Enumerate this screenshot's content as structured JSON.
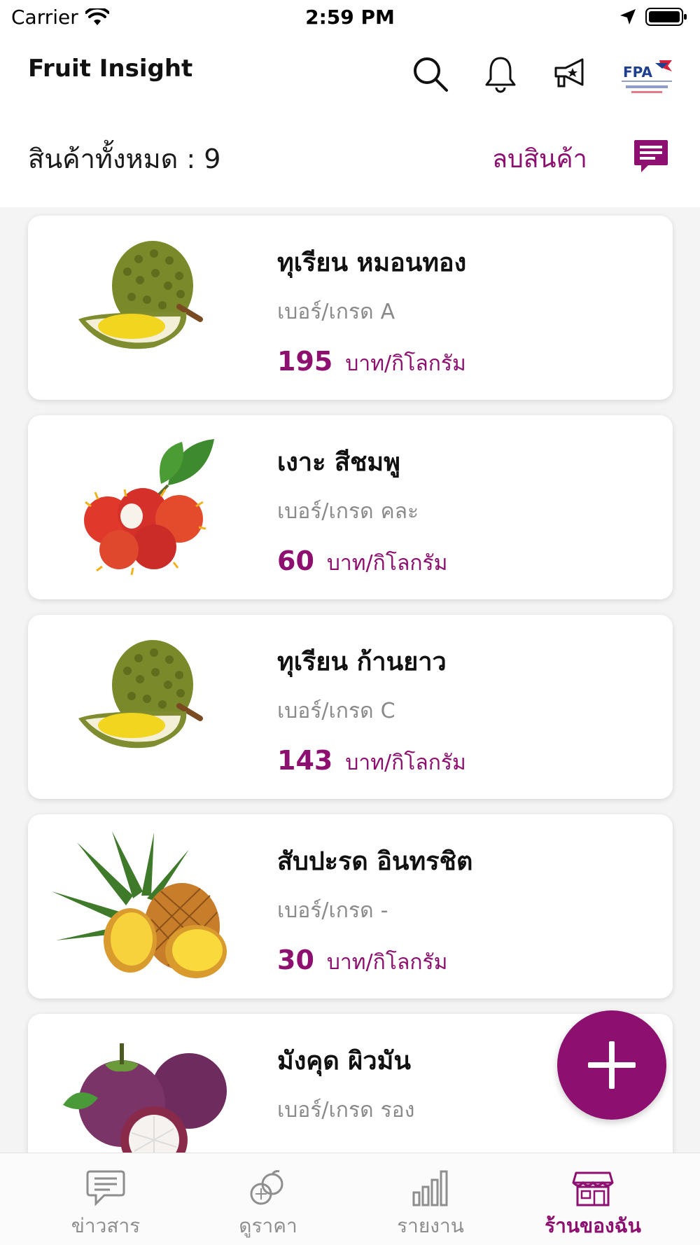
{
  "status_bar": {
    "carrier": "Carrier",
    "time": "2:59 PM"
  },
  "header": {
    "title": "Fruit Insight",
    "icons": [
      "search-icon",
      "bell-icon",
      "megaphone-icon"
    ],
    "logo_text": "FPA"
  },
  "summary": {
    "label": "สินค้าทั้งหมด : 9",
    "delete_label": "ลบสินค้า"
  },
  "products": [
    {
      "name": "ทุเรียน หมอนทอง",
      "grade_label": "เบอร์/เกรด",
      "grade": "A",
      "price": "195",
      "unit": "บาท/กิโลกรัม",
      "fruit": "durian"
    },
    {
      "name": "เงาะ สีชมพู",
      "grade_label": "เบอร์/เกรด",
      "grade": "คละ",
      "price": "60",
      "unit": "บาท/กิโลกรัม",
      "fruit": "rambutan"
    },
    {
      "name": "ทุเรียน ก้านยาว",
      "grade_label": "เบอร์/เกรด",
      "grade": "C",
      "price": "143",
      "unit": "บาท/กิโลกรัม",
      "fruit": "durian"
    },
    {
      "name": "สับปะรด อินทรชิต",
      "grade_label": "เบอร์/เกรด",
      "grade": "-",
      "price": "30",
      "unit": "บาท/กิโลกรัม",
      "fruit": "pineapple"
    },
    {
      "name": "มังคุด ผิวมัน",
      "grade_label": "เบอร์/เกรด",
      "grade": "รอง",
      "price": "",
      "unit": "",
      "fruit": "mangosteen"
    }
  ],
  "tabs": [
    {
      "label": "ข่าวสาร",
      "icon": "news-icon",
      "active": false
    },
    {
      "label": "ดูราคา",
      "icon": "fruit-price-icon",
      "active": false
    },
    {
      "label": "รายงาน",
      "icon": "bar-chart-icon",
      "active": false
    },
    {
      "label": "ร้านของฉัน",
      "icon": "store-icon",
      "active": true
    }
  ],
  "colors": {
    "accent": "#8d0f70",
    "muted": "#8a8a8a",
    "background": "#f4f4f4"
  }
}
